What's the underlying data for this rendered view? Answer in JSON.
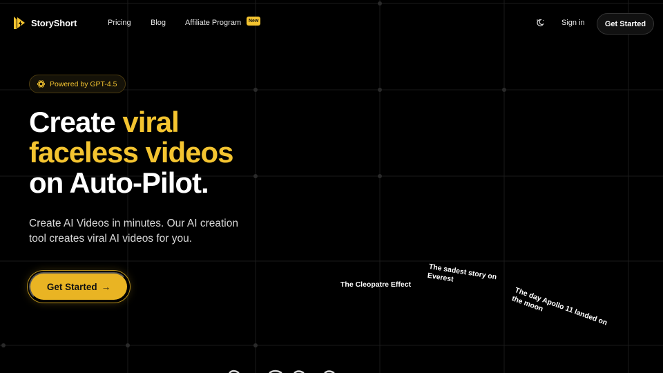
{
  "brand": {
    "name": "StoryShort",
    "accent": "#f4c430"
  },
  "nav": {
    "links": [
      "Pricing",
      "Blog",
      "Affiliate Program"
    ],
    "new_badge": "New",
    "theme_icon": "moon-sun-icon",
    "signin": "Sign in",
    "cta": "Get Started"
  },
  "hero": {
    "pill": "Powered by GPT-4.5",
    "headline": {
      "line1_a": "Create ",
      "line1_b": "viral",
      "line2": "faceless videos",
      "line3": "on Auto-Pilot."
    },
    "subtitle": "Create AI Videos in minutes. Our AI creation tool creates viral AI videos for you.",
    "cta": "Get Started",
    "cta_arrow": "→"
  },
  "videos": [
    "The Cleopatre Effect",
    "The sadest story on Everest",
    "The day Apollo 11 landed on the moon"
  ]
}
